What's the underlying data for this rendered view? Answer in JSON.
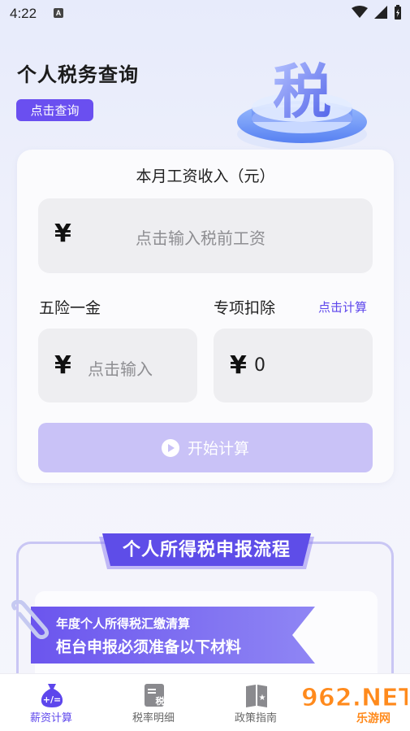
{
  "status": {
    "time": "4:22",
    "notif_badge": "A"
  },
  "header": {
    "title": "个人税务查询",
    "query_button": "点击查询",
    "art_char": "税"
  },
  "calculator": {
    "salary_label": "本月工资收入（元）",
    "currency_symbol": "¥",
    "salary_placeholder": "点击输入税前工资",
    "insurance_label": "五险一金",
    "insurance_placeholder": "点击输入",
    "deduction_label": "专项扣除",
    "deduction_link": "点击计算",
    "deduction_value": "0",
    "start_button": "开始计算"
  },
  "process": {
    "title": "个人所得税申报流程",
    "ribbon_line1": "年度个人所得税汇缴清算",
    "ribbon_line2": "柜台申报必须准备以下材料"
  },
  "nav": {
    "items": [
      {
        "label": "薪资计算",
        "icon": "money-bag-icon",
        "active": true
      },
      {
        "label": "税率明细",
        "icon": "tax-doc-icon",
        "active": false
      },
      {
        "label": "政策指南",
        "icon": "book-icon",
        "active": false
      }
    ]
  },
  "watermark": {
    "text": "962.NET",
    "sub": "乐游网"
  },
  "colors": {
    "accent": "#6a4ff0",
    "button_disabled": "#c9c2f7",
    "banner": "#5e4de8"
  }
}
